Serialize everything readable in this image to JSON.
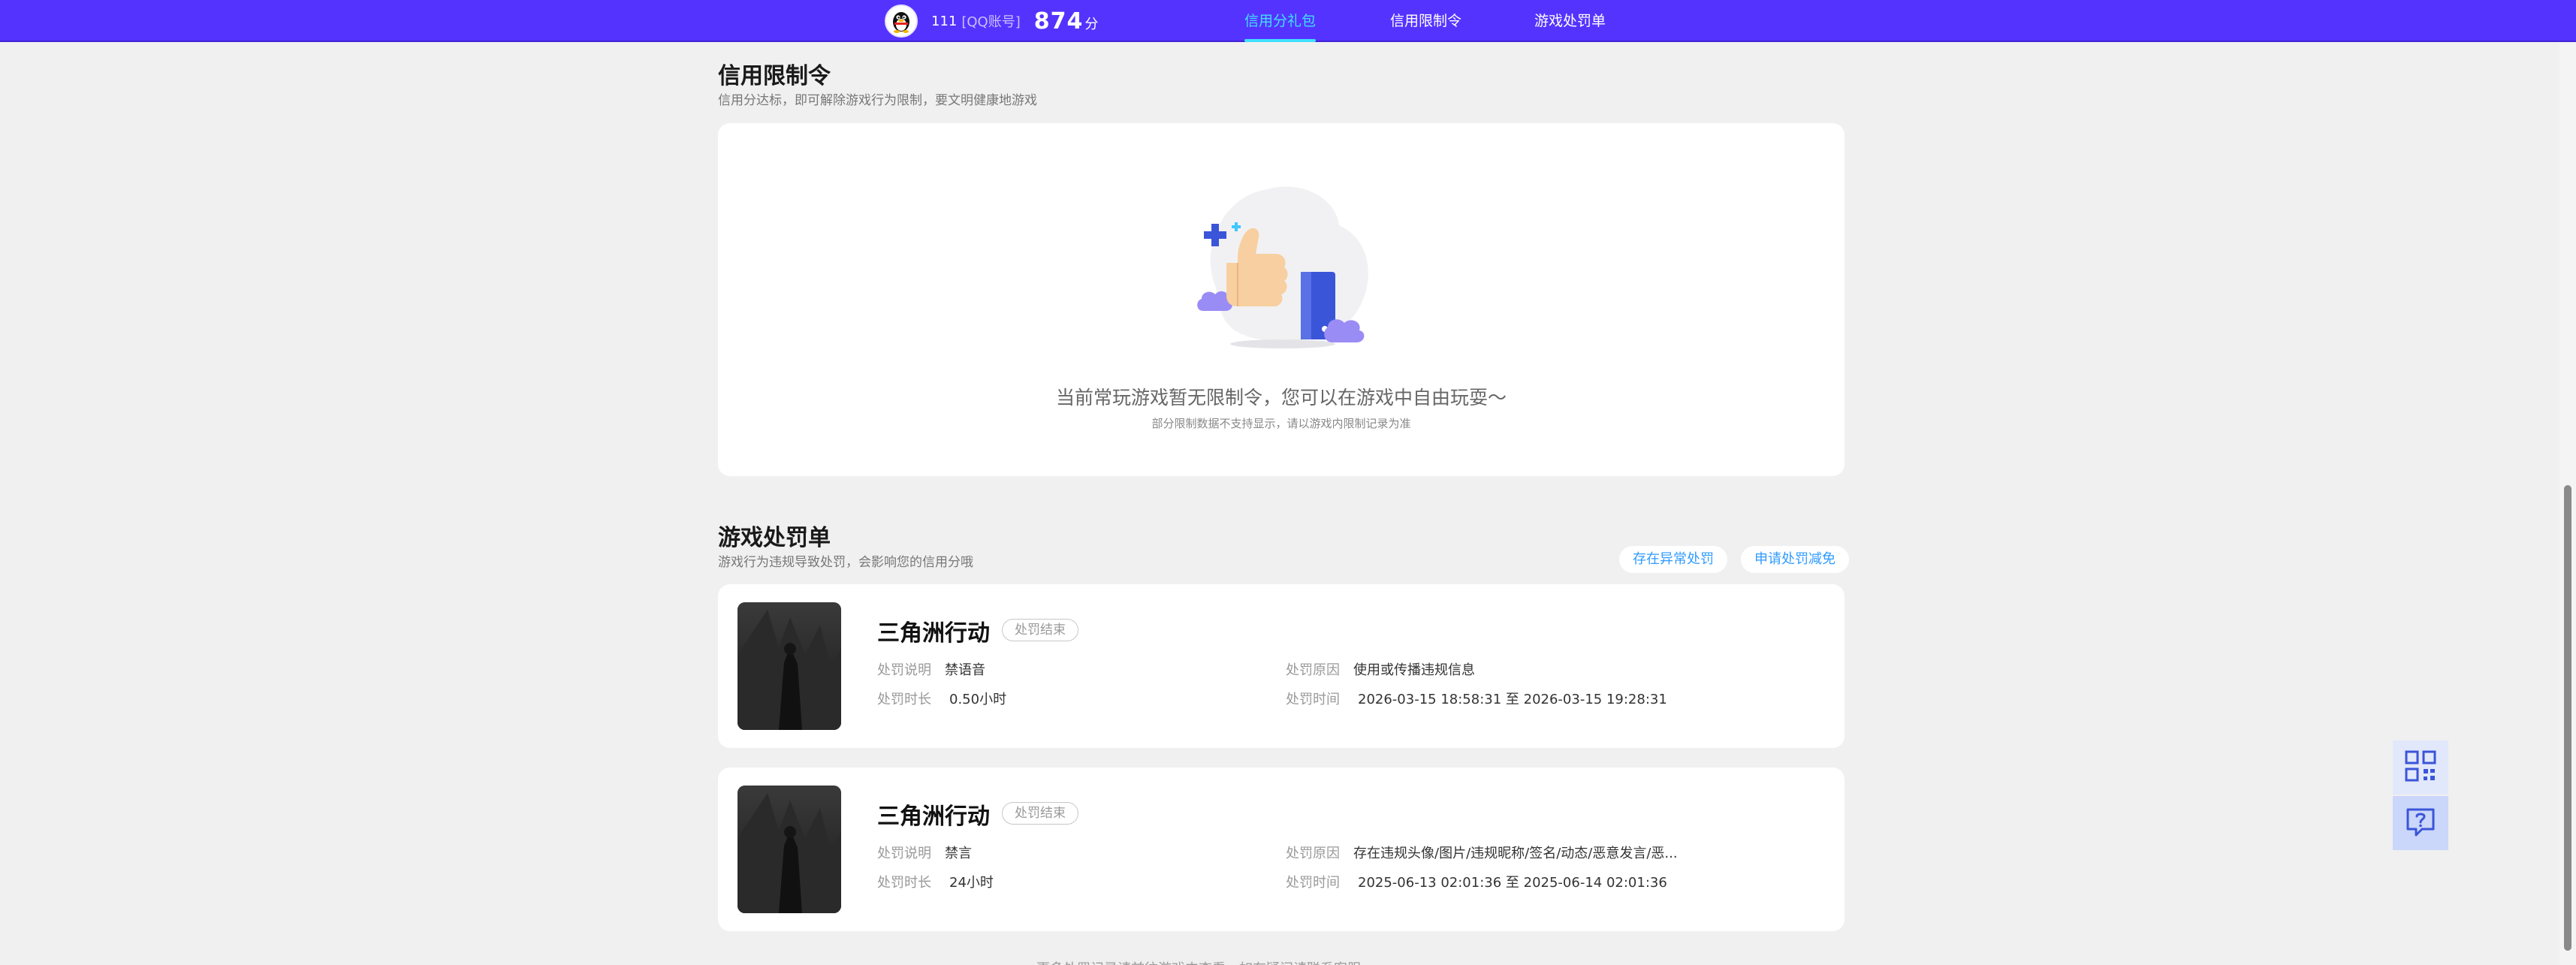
{
  "header": {
    "user_name": "111",
    "account_type": "[QQ账号]",
    "score": "874",
    "score_unit": "分",
    "tabs": [
      {
        "label": "信用分礼包",
        "active": true
      },
      {
        "label": "信用限制令",
        "active": false
      },
      {
        "label": "游戏处罚单",
        "active": false
      }
    ]
  },
  "restriction": {
    "title": "信用限制令",
    "subtitle": "信用分达标，即可解除游戏行为限制，要文明健康地游戏",
    "empty_text": "当前常玩游戏暂无限制令，您可以在游戏中自由玩耍～",
    "empty_note": "部分限制数据不支持显示，请以游戏内限制记录为准"
  },
  "punishment": {
    "title": "游戏处罚单",
    "subtitle": "游戏行为违规导致处罚，会影响您的信用分哦",
    "btn_abnormal": "存在异常处罚",
    "btn_reduce": "申请处罚减免",
    "labels": {
      "desc": "处罚说明",
      "duration": "处罚时长",
      "reason": "处罚原因",
      "time": "处罚时间"
    },
    "items": [
      {
        "game": "三角洲行动",
        "status": "处罚结束",
        "desc": "禁语音",
        "duration": "0.50小时",
        "reason": "使用或传播违规信息",
        "time": "2026-03-15 18:58:31 至 2026-03-15 19:28:31"
      },
      {
        "game": "三角洲行动",
        "status": "处罚结束",
        "desc": "禁言",
        "duration": "24小时",
        "reason": "存在违规头像/图片/违规昵称/签名/动态/恶意发言/恶...",
        "time": "2025-06-13 02:01:36 至 2025-06-14 02:01:36"
      }
    ]
  },
  "footer": {
    "hint": "更多处罚记录请前往游戏内查看，如有疑问请联系客服"
  },
  "colors": {
    "nav_bg": "#5533ff",
    "accent": "#3fe0ff",
    "link": "#2f9bff",
    "page_bg": "#f0f0f0"
  },
  "icons": [
    "qq-penguin-icon",
    "thumbs-up-illustration",
    "qrcode-icon",
    "help-chat-icon"
  ]
}
